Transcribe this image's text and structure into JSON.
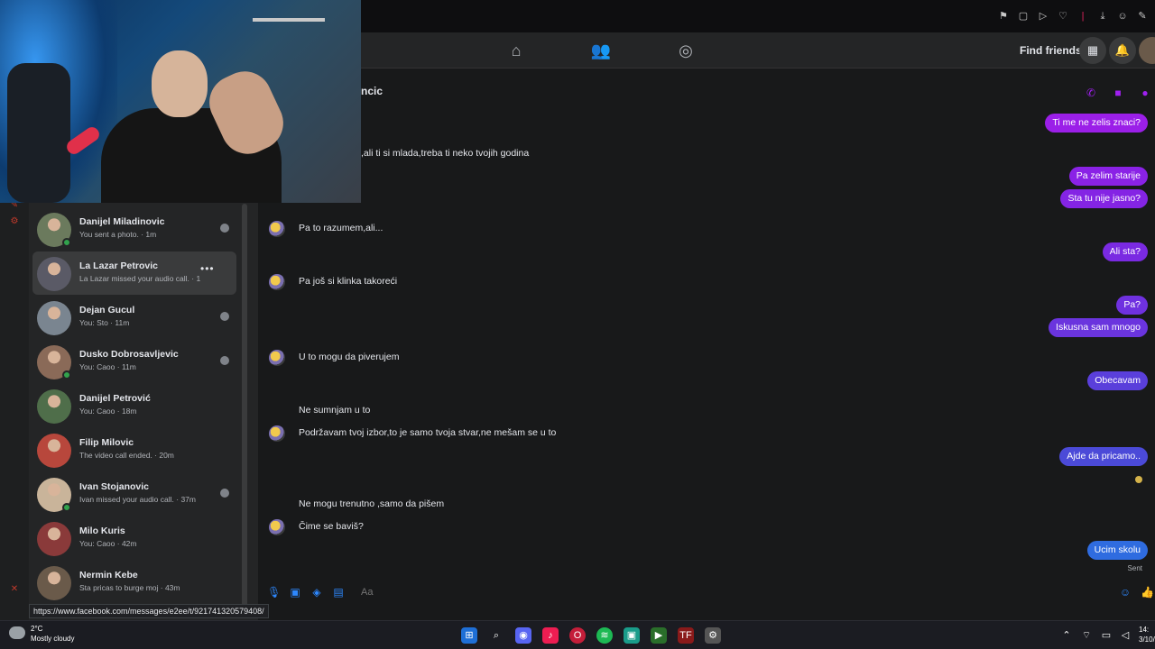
{
  "nav": {
    "find_friends_label": "Find friends"
  },
  "chat": {
    "title_partial": "ncic",
    "incoming": [
      {
        "text": ",ali ti si mlada,treba ti neko tvojih godina",
        "avatar": false
      },
      {
        "text": "Pa to razumem,ali...",
        "avatar": true
      },
      {
        "text": "Pa još si klinka takoreći",
        "avatar": true
      },
      {
        "text": "U to mogu da piverujem",
        "avatar": true
      },
      {
        "text": "Ne sumnjam u to",
        "avatar": false
      },
      {
        "text": "Podržavam tvoj izbor,to je samo tvoja stvar,ne mešam se u to",
        "avatar": true
      },
      {
        "text": "Ne mogu trenutno ,samo da pišem",
        "avatar": false
      },
      {
        "text": "Čime se baviš?",
        "avatar": true
      }
    ],
    "outgoing": [
      {
        "text": "Ti me ne zelis znaci?",
        "color": "#9b1fe8"
      },
      {
        "text": "Pa zelim starije",
        "color": "#8a22e6"
      },
      {
        "text": "Sta tu nije jasno?",
        "color": "#8424e4"
      },
      {
        "text": "Ali sta?",
        "color": "#7a2ae2"
      },
      {
        "text": "Pa?",
        "color": "#6f31e0"
      },
      {
        "text": "Iskusna sam mnogo",
        "color": "#6a34de"
      },
      {
        "text": "Obecavam",
        "color": "#5a3fdb"
      },
      {
        "text": "Ajde da pricamo..",
        "color": "#4b4ad8"
      },
      {
        "text": "Ucim skolu",
        "color": "#2f6ce0"
      }
    ],
    "sent_label": "Sent",
    "composer_placeholder": "Aa"
  },
  "contacts": [
    {
      "name": "Danijel Miladinovic",
      "sub": "You sent a photo. · 1m",
      "online": true,
      "seen": true,
      "hover": false,
      "pic": "#6b7a5d"
    },
    {
      "name": "La Lazar Petrovic",
      "sub": "La Lazar missed your audio call. · 1",
      "online": false,
      "seen": false,
      "hover": true,
      "pic": "#5a5a66"
    },
    {
      "name": "Dejan Gucul",
      "sub": "You: Sto · 11m",
      "online": false,
      "seen": true,
      "hover": false,
      "pic": "#7a8590"
    },
    {
      "name": "Dusko Dobrosavljevic",
      "sub": "You: Caoo · 11m",
      "online": true,
      "seen": true,
      "hover": false,
      "pic": "#8a6a58"
    },
    {
      "name": "Danijel Petrović",
      "sub": "You: Caoo · 18m",
      "online": false,
      "seen": false,
      "hover": false,
      "pic": "#4f6e4a"
    },
    {
      "name": "Filip Milovic",
      "sub": "The video call ended. · 20m",
      "online": false,
      "seen": false,
      "hover": false,
      "pic": "#b8473c"
    },
    {
      "name": "Ivan Stojanovic",
      "sub": "Ivan missed your audio call. · 37m",
      "online": true,
      "seen": true,
      "hover": false,
      "pic": "#c9b49a"
    },
    {
      "name": "Milo Kuris",
      "sub": "You: Caoo · 42m",
      "online": false,
      "seen": false,
      "hover": false,
      "pic": "#8a3a3a"
    },
    {
      "name": "Nermin Kebe",
      "sub": "Sta pricas to burge moj · 43m",
      "online": false,
      "seen": false,
      "hover": false,
      "pic": "#6a5a4a"
    }
  ],
  "status_link": "https://www.facebook.com/messages/e2ee/t/921741320579408/",
  "taskbar": {
    "weather_temp": "2°C",
    "weather_condition": "Mostly cloudy",
    "time": "14:",
    "date": "3/10/"
  },
  "icons": {
    "home": "home-icon",
    "friends": "friends-icon",
    "groups": "groups-icon",
    "menu": "apps-grid-icon",
    "notifications": "bell-icon",
    "phone": "phone-icon",
    "video": "video-icon",
    "info": "info-icon"
  }
}
